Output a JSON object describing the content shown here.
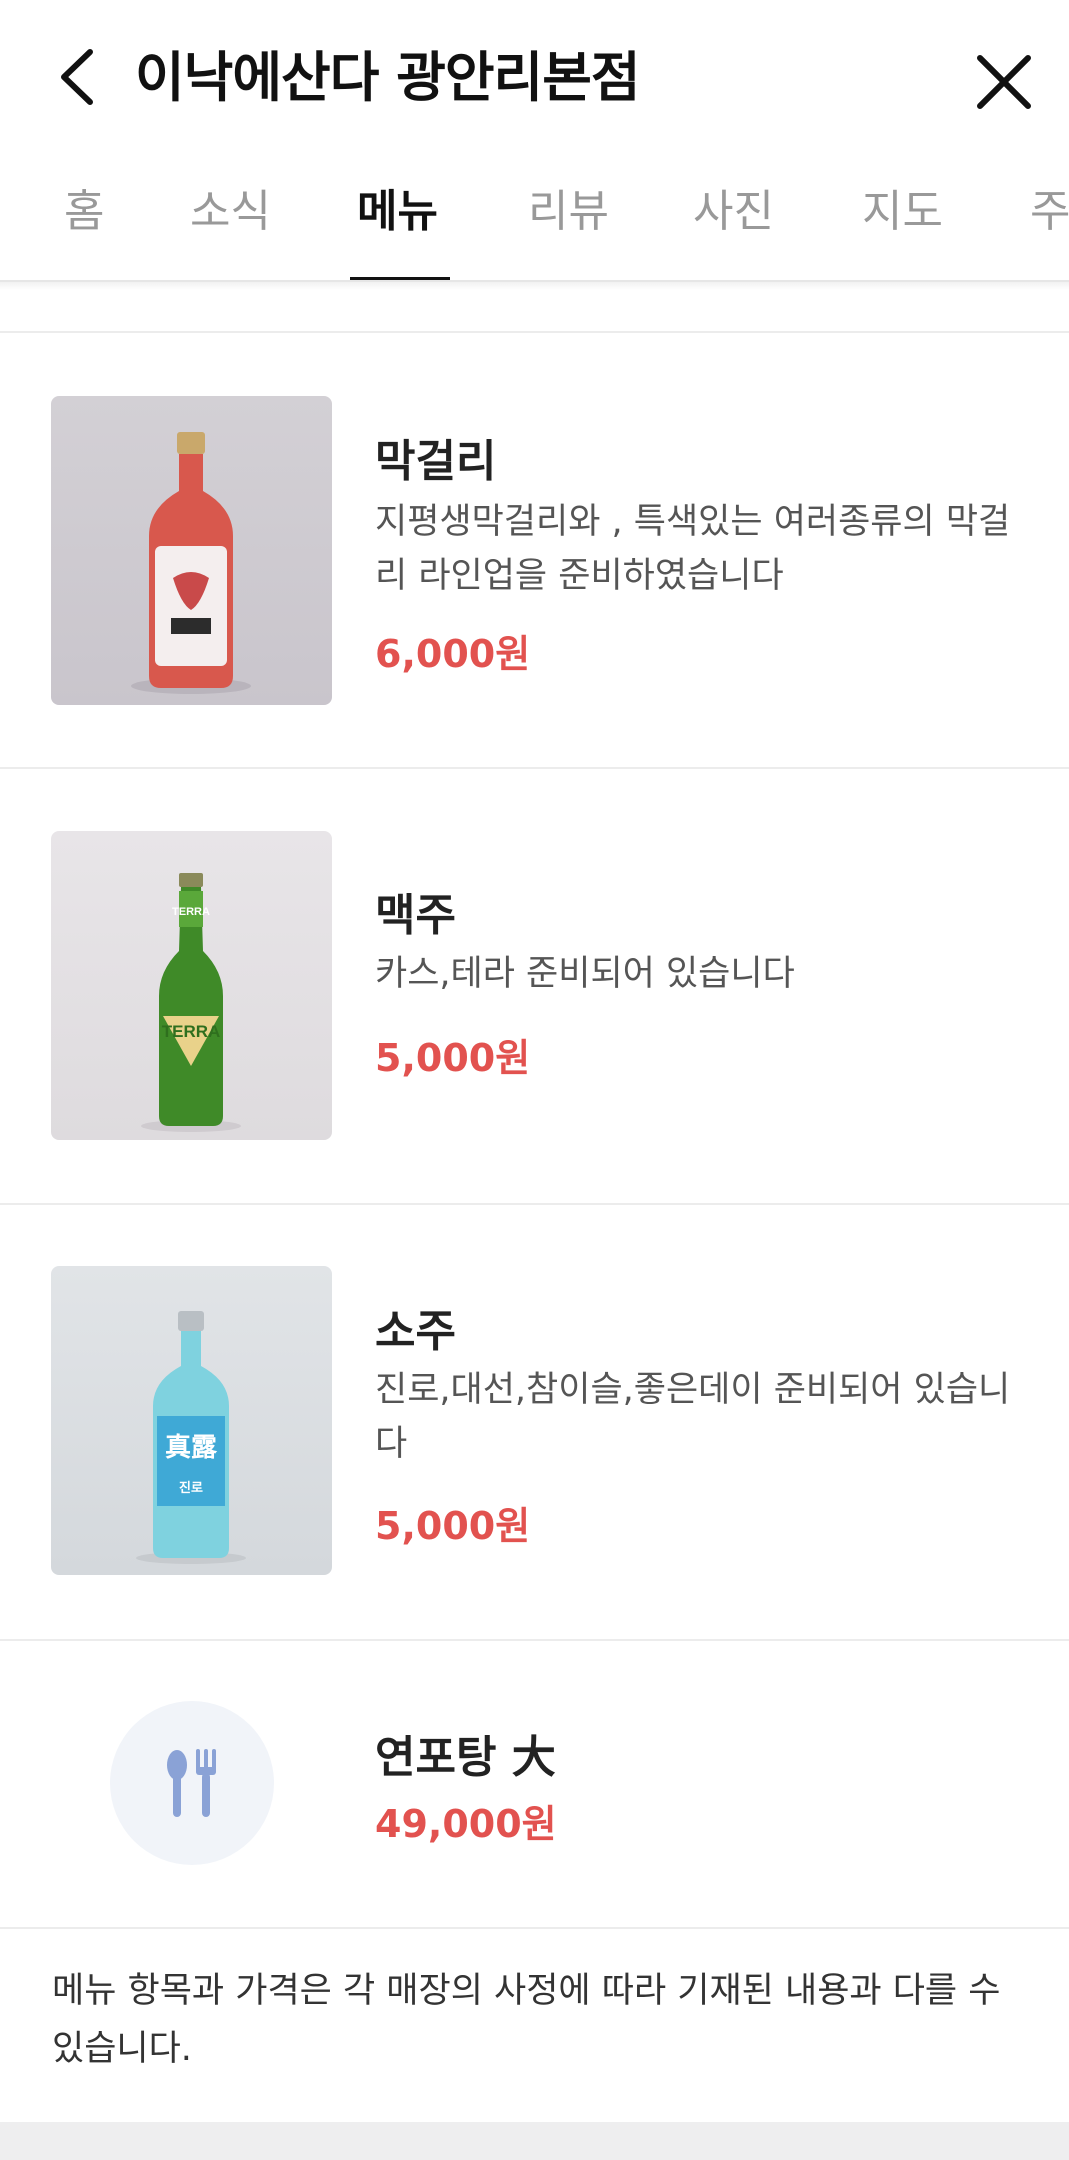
{
  "header": {
    "title": "이낙에산다 광안리본점",
    "back_icon": "chevron-left-icon",
    "close_icon": "close-icon"
  },
  "tabs": [
    {
      "label": "홈",
      "active": false
    },
    {
      "label": "소식",
      "active": false
    },
    {
      "label": "메뉴",
      "active": true
    },
    {
      "label": "리뷰",
      "active": false
    },
    {
      "label": "사진",
      "active": false
    },
    {
      "label": "지도",
      "active": false
    },
    {
      "label": "주",
      "active": false
    }
  ],
  "menu": [
    {
      "name": "막걸리",
      "desc": "지평생막걸리와 , 특색있는 여러종류의 막걸리 라인업을 준비하였습니다",
      "price": "6,000원",
      "image": "makgeolli-bottle-image"
    },
    {
      "name": "맥주",
      "desc": "카스,테라 준비되어 있습니다",
      "price": "5,000원",
      "image": "beer-bottle-image",
      "label_text": "TERRA"
    },
    {
      "name": "소주",
      "desc": "진로,대선,참이슬,좋은데이 준비되어 있습니다",
      "price": "5,000원",
      "image": "soju-bottle-image",
      "label_text": "真露",
      "label_sub": "진로"
    },
    {
      "name": "연포탕 大",
      "desc": "",
      "price": "49,000원",
      "image": "utensils-icon"
    }
  ],
  "notice": "메뉴 항목과 가격은 각 매장의 사정에 따라 기재된 내용과 다를 수 있습니다.",
  "colors": {
    "price": "#e2524f",
    "active_tab": "#111111",
    "inactive_tab": "#999999"
  }
}
